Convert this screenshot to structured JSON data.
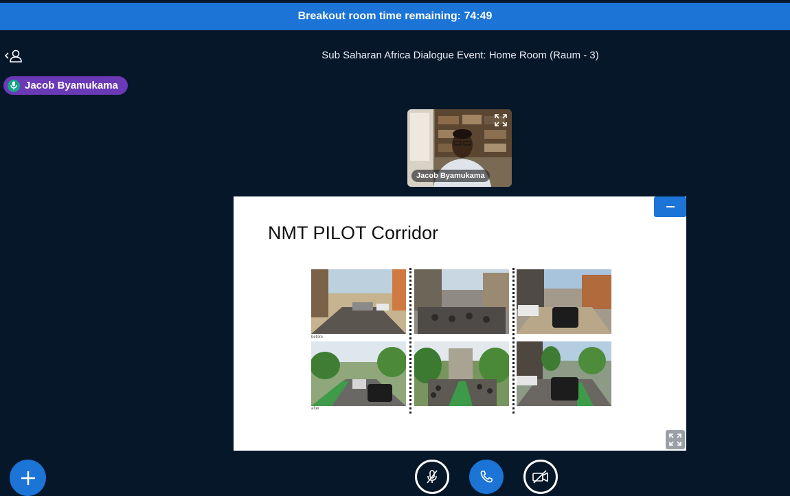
{
  "banner": {
    "text": "Breakout room time remaining: 74:49"
  },
  "header": {
    "title": "Sub Saharan Africa Dialogue Event: Home Room (Raum - 3)"
  },
  "talking_indicator": {
    "name": "Jacob Byamukama"
  },
  "webcam": {
    "name": "Jacob Byamukama"
  },
  "presentation": {
    "title": "NMT PILOT Corridor",
    "captions": {
      "before": "before",
      "after": "after"
    }
  },
  "icons": {
    "users_toggle": "back-users-icon",
    "mic": "microphone-icon",
    "fullscreen": "fullscreen-icon",
    "minimize": "minimize-icon",
    "add": "plus-icon",
    "mute": "microphone-off-icon",
    "phone": "phone-icon",
    "camera": "camera-off-icon"
  },
  "colors": {
    "accent": "#1b74d6",
    "background": "#06172a",
    "talker": "#6a39b5",
    "mic_green": "#17a589"
  }
}
